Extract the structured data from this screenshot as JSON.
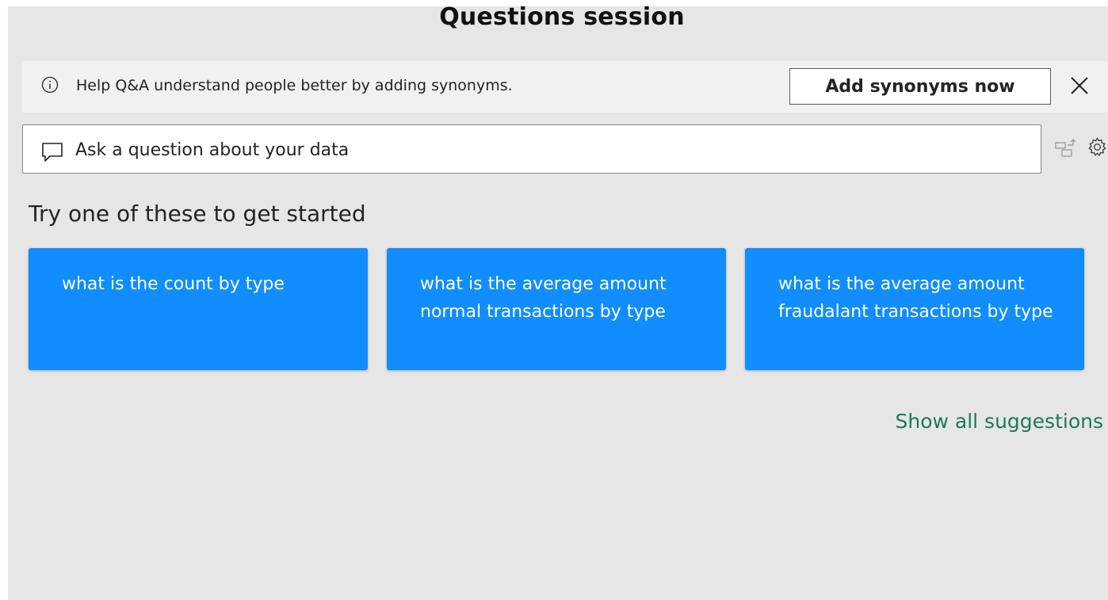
{
  "header": {
    "title": "Questions session"
  },
  "banner": {
    "icon": "info-icon",
    "message": "Help Q&A understand people better by adding synonyms.",
    "add_synonyms_label": "Add synonyms now",
    "close_icon": "close-icon"
  },
  "qa_input": {
    "icon": "chat-icon",
    "placeholder": "Ask a question about your data"
  },
  "toolbar": {
    "turn_into_visual_icon": "turn-into-visual-icon",
    "settings_icon": "gear-icon"
  },
  "suggestions": {
    "heading": "Try one of these to get started",
    "items": [
      "what is the count by type",
      "what is the average amount normal transactions by type",
      "what is the average amount fraudalant transactions by type"
    ],
    "show_all_label": "Show all suggestions"
  },
  "colors": {
    "panel_background": "#e6e6e6",
    "card_blue": "#118dff",
    "link_green": "#1e7a55"
  }
}
